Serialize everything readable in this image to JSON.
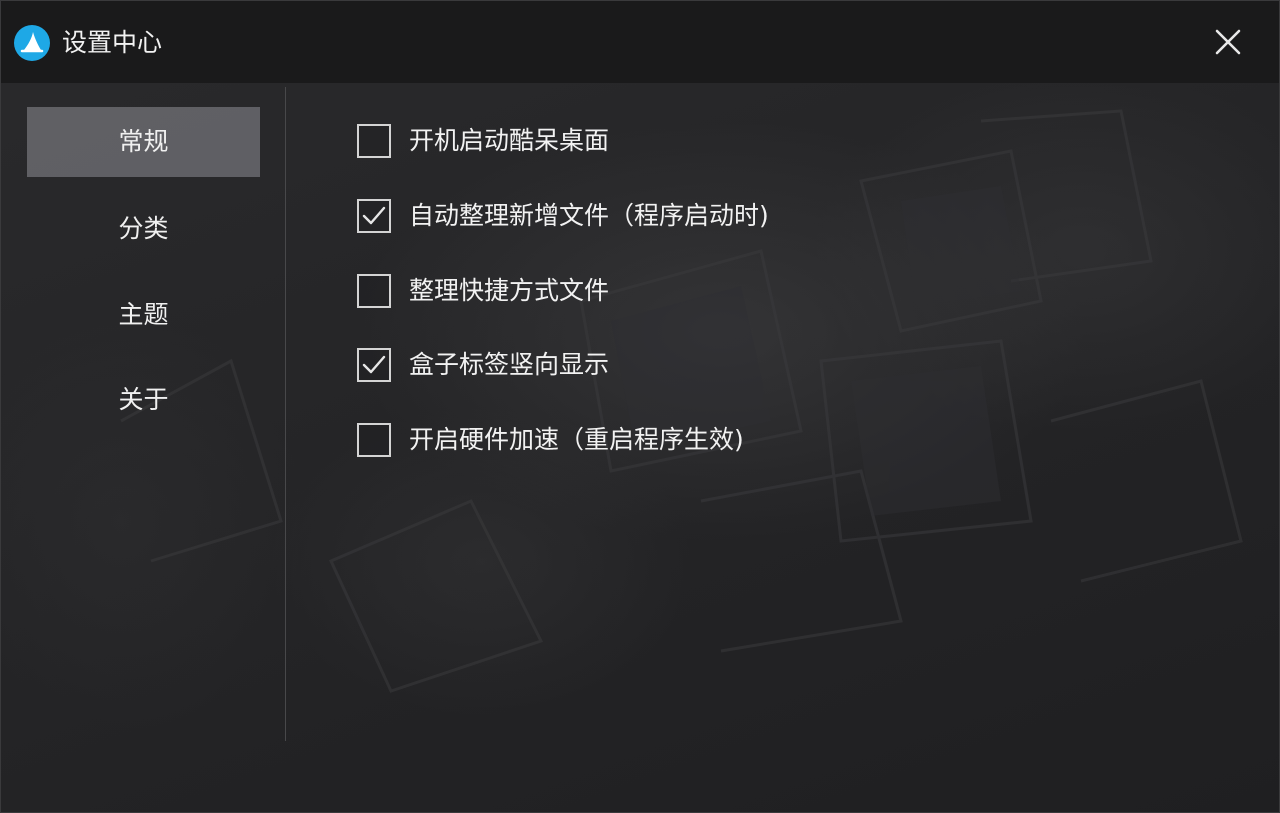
{
  "window": {
    "title": "设置中心",
    "app_icon": "app-logo-icon",
    "close_icon": "close-icon"
  },
  "sidebar": {
    "items": [
      {
        "label": "常规",
        "active": true
      },
      {
        "label": "分类",
        "active": false
      },
      {
        "label": "主题",
        "active": false
      },
      {
        "label": "关于",
        "active": false
      }
    ]
  },
  "options": [
    {
      "label": "开机启动酷呆桌面",
      "checked": false
    },
    {
      "label": "自动整理新增文件（程序启动时)",
      "checked": true
    },
    {
      "label": "整理快捷方式文件",
      "checked": false
    },
    {
      "label": "盒子标签竖向显示",
      "checked": true
    },
    {
      "label": "开启硬件加速（重启程序生效)",
      "checked": false
    }
  ],
  "colors": {
    "titlebar": "#1a1a1b",
    "active_nav": "#6e6e72",
    "logo_blue": "#1ea8e6"
  }
}
